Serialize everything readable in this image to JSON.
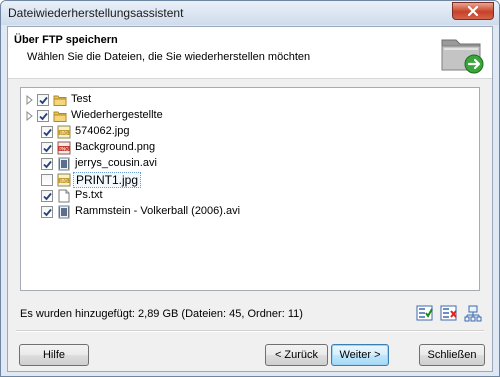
{
  "window": {
    "title": "Dateiwiederherstellungsassistent"
  },
  "header": {
    "title": "Über FTP speichern",
    "subtitle": "Wählen Sie die Dateien, die Sie wiederherstellen möchten",
    "icon": "ftp-folder-icon"
  },
  "tree": {
    "items": [
      {
        "label": "Test",
        "type": "folder",
        "checked": true,
        "icon": "folder-icon",
        "expandable": true
      },
      {
        "label": "Wiederhergestellte",
        "type": "folder",
        "checked": true,
        "icon": "folder-icon",
        "expandable": true
      },
      {
        "label": "574062.jpg",
        "type": "file",
        "checked": true,
        "icon": "jpg-file-icon",
        "expandable": false
      },
      {
        "label": "Background.png",
        "type": "file",
        "checked": true,
        "icon": "png-file-icon",
        "expandable": false
      },
      {
        "label": "jerrys_cousin.avi",
        "type": "file",
        "checked": true,
        "icon": "video-file-icon",
        "expandable": false
      },
      {
        "label": "PRINT1.jpg",
        "type": "file",
        "checked": false,
        "icon": "jpg-file-icon",
        "expandable": false,
        "selected": true
      },
      {
        "label": "Ps.txt",
        "type": "file",
        "checked": true,
        "icon": "text-file-icon",
        "expandable": false
      },
      {
        "label": "Rammstein - Volkerball (2006).avi",
        "type": "file",
        "checked": true,
        "icon": "video-file-icon",
        "expandable": false
      }
    ]
  },
  "status": {
    "text": "Es wurden hinzugefügt: 2,89 GB (Dateien: 45, Ordner: 11)"
  },
  "toolbar": {
    "icons": [
      "check-all-icon",
      "uncheck-all-icon",
      "filter-icon"
    ]
  },
  "buttons": {
    "help": "Hilfe",
    "back": "< Zurück",
    "next": "Weiter >",
    "close": "Schließen"
  },
  "colors": {
    "titlebar": "#dfe8f3",
    "close_button": "#c8412a",
    "default_button": "#3c7fb1"
  }
}
